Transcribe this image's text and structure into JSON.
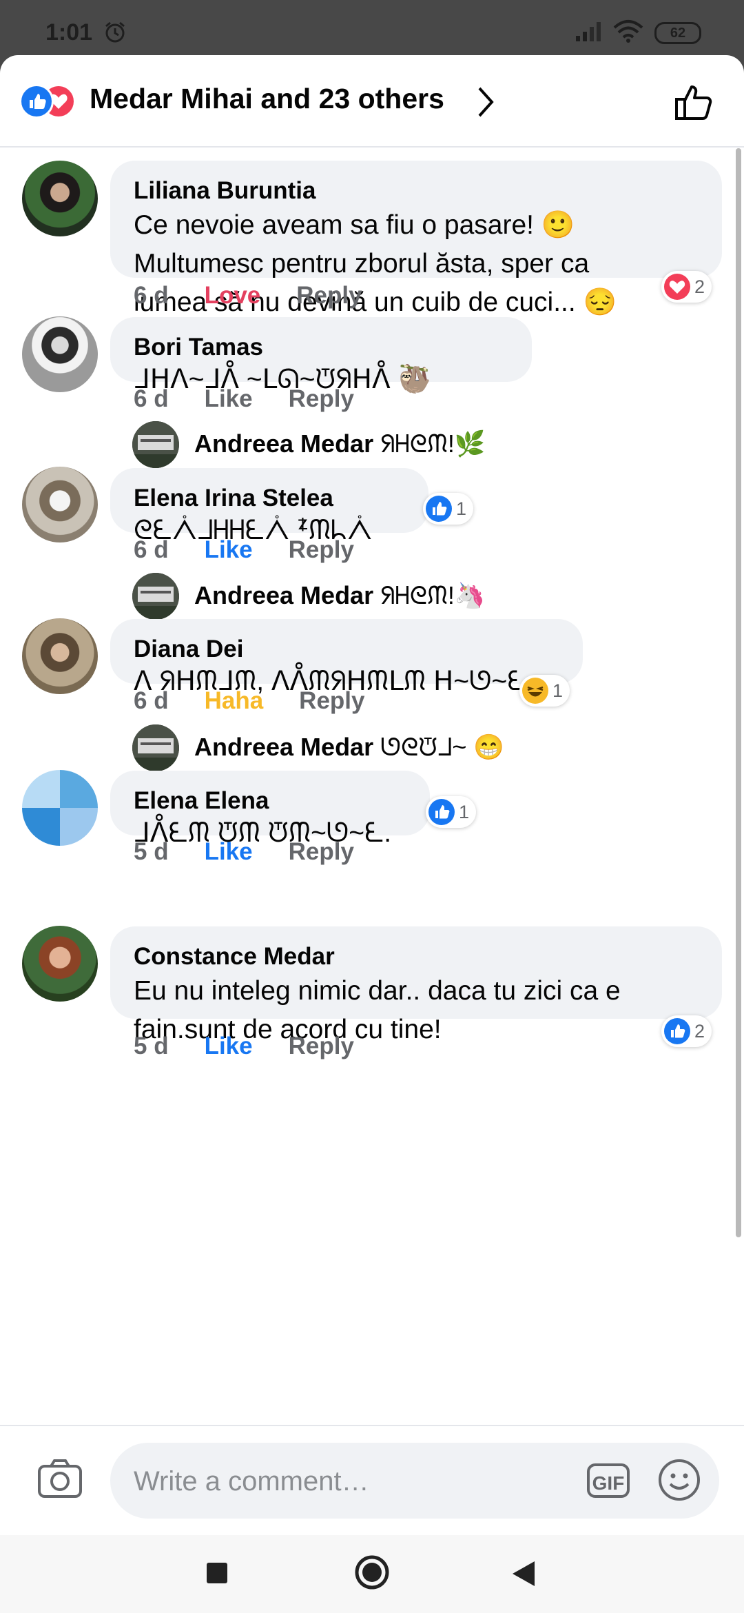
{
  "status_bar": {
    "time": "1:01",
    "battery": "62"
  },
  "header": {
    "title": "Medar Mihai and 23 others"
  },
  "comments": [
    {
      "name": "Liliana Buruntia",
      "text_lines": [
        "Ce nevoie aveam sa fiu o pasare! 🙂",
        "Multumesc pentru zborul ăsta, sper ca",
        "lumea să nu devină un cuib de cuci... 😔"
      ],
      "time": "6 d",
      "reaction": "Love",
      "reply": "Reply",
      "badge_count": "2",
      "badge_type": "love"
    },
    {
      "name": "Bori Tamas",
      "text_lines": [
        "ᒧᕼᐱ~ᒧᐰ ~ᒪᘏ~ᙈᖆᕼᐰ 🦥"
      ],
      "time": "6 d",
      "reaction": "Like",
      "reply": "Reply"
    },
    {
      "name": "Elena Irina Stelea",
      "text_lines": [
        "ᘓᘍᐰᒧᕼᕼᘍᐰ ᙇᙏᖺᐰ"
      ],
      "time": "6 d",
      "reaction": "Like",
      "reply": "Reply",
      "badge_count": "1",
      "badge_type": "like"
    },
    {
      "name": "Diana Dei",
      "text_lines": [
        "ᐱ ᖆᕼᙏᒧᙏ, ᐱᐰᙏᖆᕼᙏᒪᙏ ᕼ~ᘎ~ᘍ."
      ],
      "time": "6 d",
      "reaction": "Haha",
      "reply": "Reply",
      "badge_count": "1",
      "badge_type": "haha"
    },
    {
      "name": "Elena Elena",
      "text_lines": [
        "ᒧᐰᘍᙏ ᙈᙏ ᙈᙏ~ᘎ~ᘍ."
      ],
      "time": "5 d",
      "reaction": "Like",
      "reply": "Reply",
      "badge_count": "1",
      "badge_type": "like"
    },
    {
      "name": "Constance Medar",
      "text_lines": [
        "Eu nu inteleg  nimic dar.. daca tu zici ca e",
        "fain.sunt de acord cu tine!"
      ],
      "time": "5 d",
      "reaction": "Like",
      "reply": "Reply",
      "badge_count": "2",
      "badge_type": "like"
    }
  ],
  "replies": [
    {
      "name": "Andreea Medar",
      "text": "ᖆᕼᘓᙏ!🌿"
    },
    {
      "name": "Andreea Medar",
      "text": "ᖆᕼᘓᙏ!🦄"
    },
    {
      "name": "Andreea Medar",
      "text": "ᘎᘓᙈᒧ~ 😁"
    }
  ],
  "composer": {
    "placeholder": "Write a comment…",
    "gif": "GIF"
  },
  "colors": {
    "like": "#1877f2",
    "love": "#e4405f",
    "haha": "#f7b928",
    "bubble": "#f0f2f5",
    "meta": "#65676b"
  },
  "icons": [
    "alarm-icon",
    "signal-icon",
    "wifi-icon",
    "like-icon",
    "love-icon",
    "chevron-right-icon",
    "thumbs-up-icon",
    "camera-icon",
    "emoji-icon",
    "recents-icon",
    "home-icon",
    "back-icon"
  ]
}
